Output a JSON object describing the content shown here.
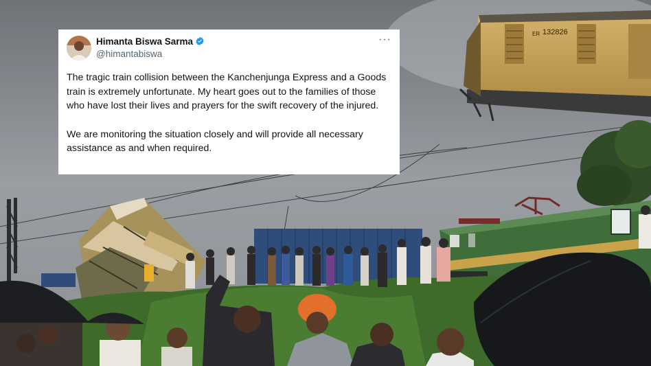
{
  "tweet": {
    "author_name": "Himanta Biswa Sarma",
    "handle": "@himantabiswa",
    "verified": true,
    "more_glyph": "···",
    "paragraph_1": "The tragic train collision between the Kanchenjunga Express and a Goods train is extremely unfortunate. My heart goes out to the families of those who have lost their lives and prayers for the swift recovery of the injured.",
    "paragraph_2": "We are monitoring the situation closely and will provide all necessary assistance as and when required."
  },
  "photo": {
    "coach_number": "132826",
    "coach_code": "ER",
    "colors": {
      "sky": "#8e9297",
      "grass": "#3e6b2a",
      "locomotive": "#3f6e3a",
      "coach": "#c9a456",
      "container": "#2f4d7a"
    }
  }
}
